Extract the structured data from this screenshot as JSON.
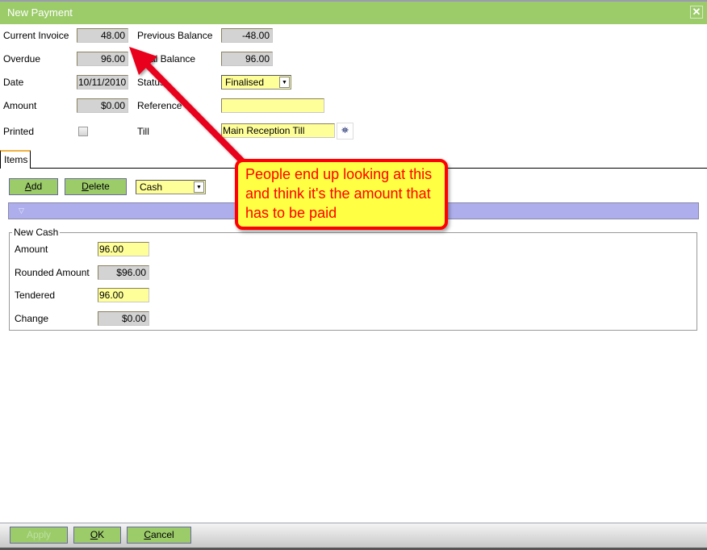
{
  "window": {
    "title": "New Payment",
    "close_icon": "close-icon"
  },
  "form": {
    "current_invoice": {
      "label": "Current Invoice",
      "value": "48.00"
    },
    "previous_balance": {
      "label": "Previous Balance",
      "value": "-48.00"
    },
    "overdue": {
      "label": "Overdue",
      "value": "96.00"
    },
    "total_balance": {
      "label": "Total Balance",
      "value": "96.00"
    },
    "date": {
      "label": "Date",
      "value": "10/11/2010"
    },
    "status": {
      "label": "Status",
      "value": "Finalised"
    },
    "amount": {
      "label": "Amount",
      "value": "$0.00"
    },
    "reference": {
      "label": "Reference",
      "value": ""
    },
    "printed": {
      "label": "Printed",
      "checked": false
    },
    "till": {
      "label": "Till",
      "value": "Main Reception Till",
      "search_icon": "binoculars-icon"
    }
  },
  "tabs": [
    {
      "label": "Items"
    }
  ],
  "items": {
    "add_label": "Add",
    "delete_label": "Delete",
    "type_select": "Cash"
  },
  "new_cash": {
    "title": "New Cash",
    "amount": {
      "label": "Amount",
      "value": "96.00"
    },
    "rounded_amount": {
      "label": "Rounded Amount",
      "value": "$96.00"
    },
    "tendered": {
      "label": "Tendered",
      "value": "96.00"
    },
    "change": {
      "label": "Change",
      "value": "$0.00"
    }
  },
  "footer": {
    "apply_label": "Apply",
    "ok_label": "OK",
    "cancel_label": "Cancel"
  },
  "annotation": {
    "text": "People end up looking at this and think it's the amount that has to be paid"
  }
}
